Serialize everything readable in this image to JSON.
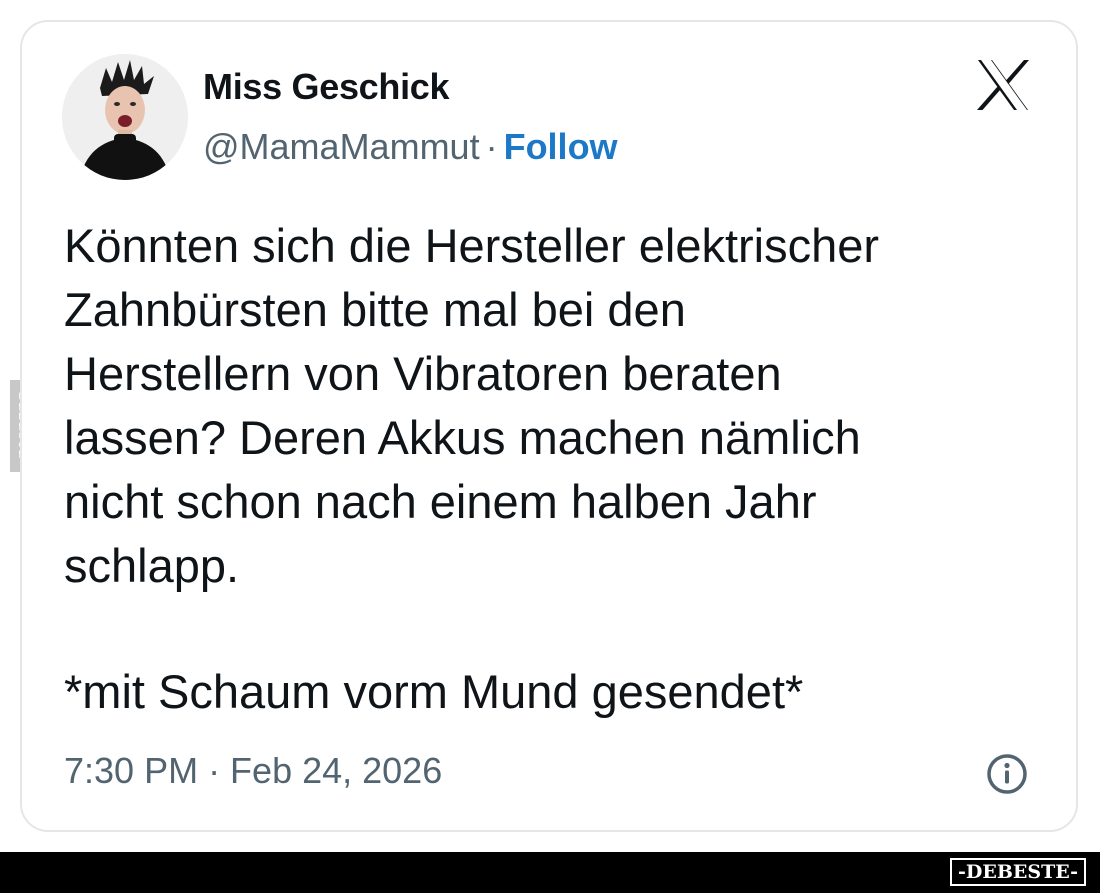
{
  "tweet": {
    "display_name": "Miss Geschick",
    "handle": "@MamaMammut",
    "separator": "·",
    "follow_label": "Follow",
    "body_lines": [
      "Könnten sich die Hersteller elektrischer",
      "Zahnbürsten bitte mal bei den",
      "Herstellern von Vibratoren beraten",
      "lassen? Deren Akkus machen nämlich",
      "nicht schon nach einem halben Jahr",
      "schlapp."
    ],
    "signature": "*mit Schaum vorm Mund gesendet*",
    "timestamp": "7:30 PM · Feb 24, 2026"
  },
  "icons": {
    "platform_logo": "x-logo-icon",
    "info": "info-icon",
    "avatar": "avatar"
  },
  "watermark": {
    "side_text": "DEBESTE",
    "footer_text": "-DEBESTE-"
  },
  "colors": {
    "text_primary": "#0f1419",
    "text_secondary": "#536471",
    "follow_link": "#1d78c8",
    "card_border": "#e4e6e8",
    "footer_bar": "#000000"
  }
}
